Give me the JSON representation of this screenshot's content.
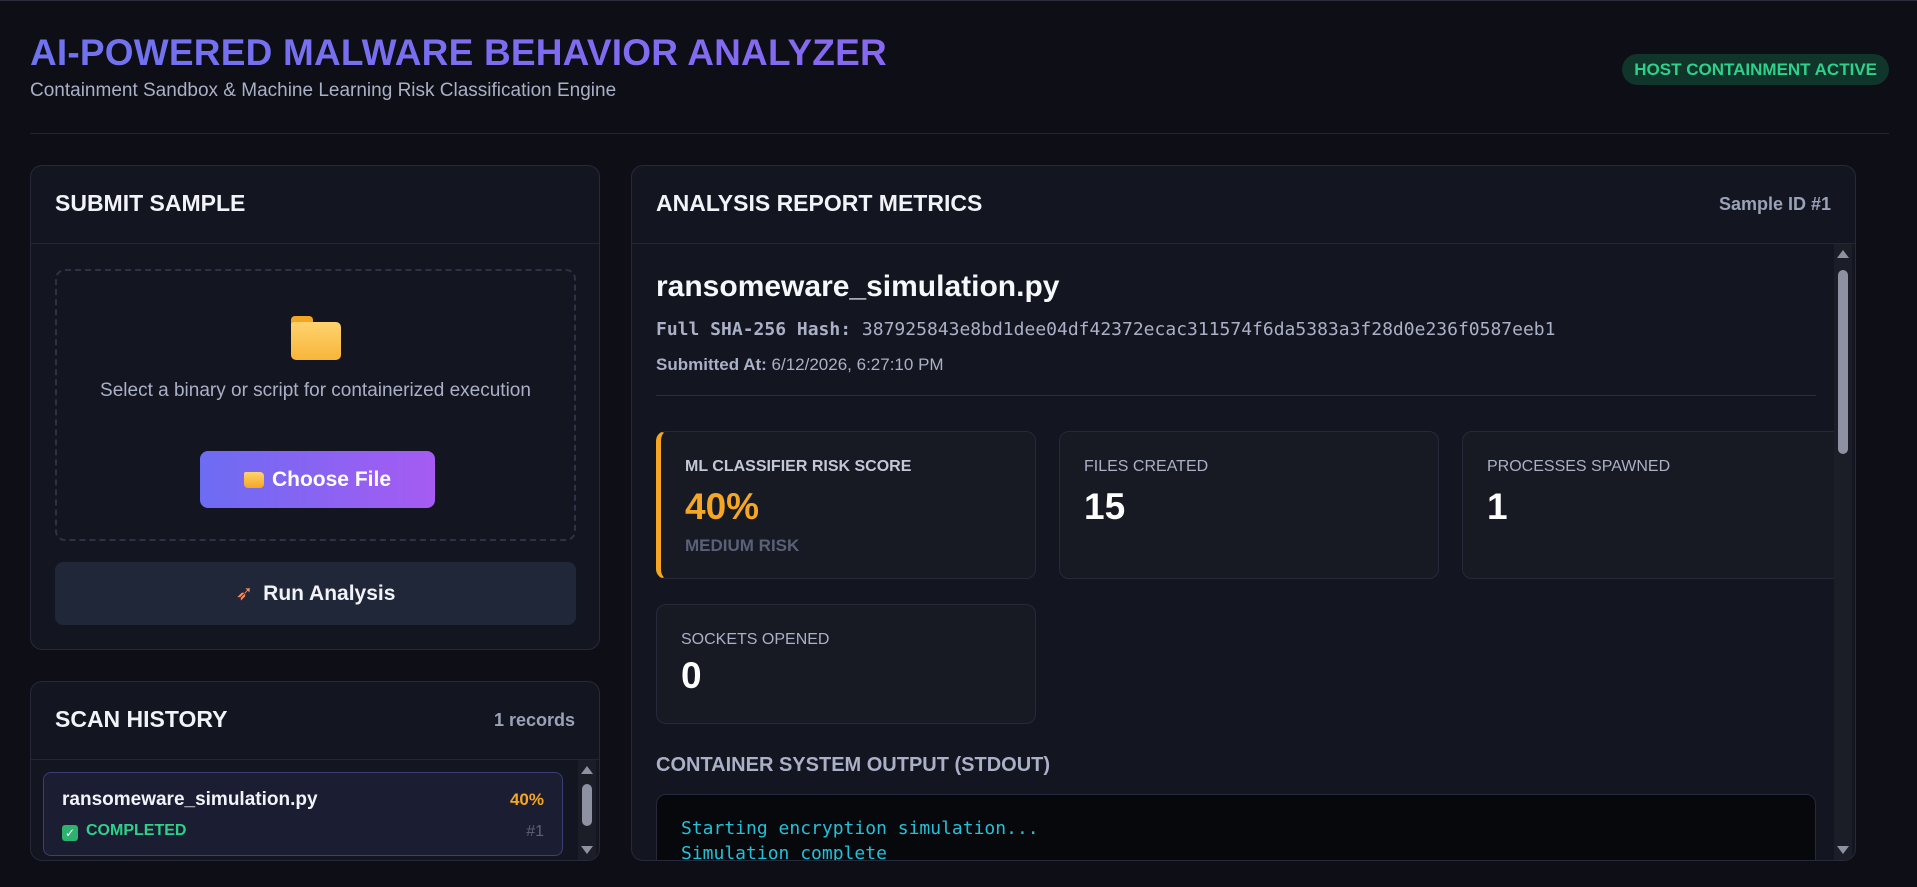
{
  "header": {
    "title": "AI-POWERED MALWARE BEHAVIOR ANALYZER",
    "subtitle": "Containment Sandbox & Machine Learning Risk Classification Engine",
    "badge": "HOST CONTAINMENT ACTIVE"
  },
  "submit": {
    "title": "SUBMIT SAMPLE",
    "dropzone_text": "Select a binary or script for containerized execution",
    "choose_label": "Choose File",
    "run_label": "Run Analysis"
  },
  "history": {
    "title": "SCAN HISTORY",
    "count": "1 records",
    "items": [
      {
        "name": "ransomeware_simulation.py",
        "score": "40%",
        "status": "COMPLETED",
        "id": "#1"
      }
    ]
  },
  "report": {
    "title": "ANALYSIS REPORT METRICS",
    "sample_id": "Sample ID #1",
    "file_name": "ransomeware_simulation.py",
    "hash_label": "Full SHA-256 Hash:",
    "hash_value": "387925843e8bd1dee04df42372ecac311574f6da5383a3f28d0e236f0587eeb1",
    "submitted_label": "Submitted At:",
    "submitted_value": "6/12/2026, 6:27:10 PM",
    "cards": {
      "risk": {
        "label": "ML CLASSIFIER RISK SCORE",
        "value": "40%",
        "sub": "MEDIUM RISK"
      },
      "files": {
        "label": "FILES CREATED",
        "value": "15"
      },
      "processes": {
        "label": "PROCESSES SPAWNED",
        "value": "1"
      },
      "sockets": {
        "label": "SOCKETS OPENED",
        "value": "0"
      }
    },
    "stdout_title": "CONTAINER SYSTEM OUTPUT (STDOUT)",
    "stdout_lines": [
      "Starting encryption simulation...",
      "Simulation complete"
    ]
  },
  "colors": {
    "accent_start": "#6f73ef",
    "accent_end": "#a35af0",
    "success": "#2fd18a",
    "warning": "#f5a623",
    "console_text": "#22c1d9"
  },
  "icons": [
    "folder-icon",
    "rocket-icon",
    "check-icon"
  ]
}
